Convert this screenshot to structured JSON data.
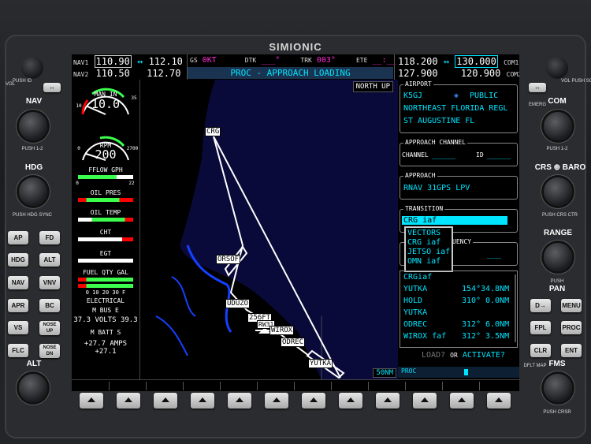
{
  "brand": "SIMIONIC",
  "nav": {
    "nav1_label": "NAV1",
    "nav1_active": "110.90",
    "nav1_arrow": "↔",
    "nav1_standby": "112.10",
    "nav2_label": "NAV2",
    "nav2_active": "110.50",
    "nav2_standby": "112.70"
  },
  "status": {
    "gs_label": "GS",
    "gs_value": "0KT",
    "dtk_label": "DTK",
    "dtk_value": "___°",
    "trk_label": "TRK",
    "trk_value": "003°",
    "ete_label": "ETE",
    "ete_value": "__:__",
    "proc_banner": "PROC - APPROACH LOADING"
  },
  "com": {
    "com1_active": "118.200",
    "com1_arrow": "↔",
    "com1_standby": "130.000",
    "com1_label": "COM1",
    "com2_active": "127.900",
    "com2_standby": "120.900",
    "com2_label": "COM2"
  },
  "eis": {
    "man_in_label": "MAN IN",
    "man_in_value": "10.0",
    "man_min": "10",
    "man_max": "35",
    "rpm_label": "RPM",
    "rpm_value": "200",
    "rpm_min": "0",
    "rpm_max": "2700",
    "fflow_label": "FFLOW GPH",
    "fflow_min": "0",
    "fflow_max": "22",
    "oil_pres_label": "OIL PRES",
    "oil_temp_label": "OIL TEMP",
    "cht_label": "CHT",
    "egt_label": "EGT",
    "fuel_label": "FUEL QTY GAL",
    "fuel_scale": "0   10  20  30 F",
    "elec_label": "ELECTRICAL",
    "bus_row": "M   BUS   E",
    "volts_row": "37.3 VOLTS 39.3",
    "batt_row": "M   BATT   S",
    "amps_row": "+27.7 AMPS +27.1"
  },
  "map": {
    "orientation": "NORTH UP",
    "range": "50NM",
    "waypoints": [
      {
        "name": "CRG"
      },
      {
        "name": "ORSOF"
      },
      {
        "name": "UDUZO"
      },
      {
        "name": "256FT"
      },
      {
        "name": "RW31"
      },
      {
        "name": "WIROX"
      },
      {
        "name": "ODREC"
      },
      {
        "name": "YUTKA"
      }
    ]
  },
  "fms": {
    "airport_title": "AIRPORT",
    "airport_id": "K5GJ",
    "airport_type": "PUBLIC",
    "airport_name": "NORTHEAST FLORIDA REGL",
    "airport_city": "ST AUGUSTINE FL",
    "channel_title": "APPROACH CHANNEL",
    "channel_label": "CHANNEL",
    "channel_value": "_____",
    "id_label": "ID",
    "id_value": "_____",
    "approach_title": "APPROACH",
    "approach_value": "RNAV 31GPS LPV",
    "transition_title": "TRANSITION",
    "transition_value": "CRG iaf",
    "dropdown": [
      "VECTORS",
      "CRG iaf",
      "JETSO iaf",
      "OMN iaf"
    ],
    "freq_title": "UENCY",
    "freq_value": "___",
    "legs": [
      {
        "name": "CRGiaf",
        "crs": "",
        "dist": ""
      },
      {
        "name": "YUTKA",
        "crs": "154°",
        "dist": "34.8NM"
      },
      {
        "name": "HOLD",
        "crs": "310°",
        "dist": "0.0NM"
      },
      {
        "name": "YUTKA",
        "crs": "",
        "dist": ""
      },
      {
        "name": "ODREC",
        "crs": "312°",
        "dist": "6.0NM"
      },
      {
        "name": "WIROX faf",
        "crs": "312°",
        "dist": "3.5NM"
      }
    ],
    "load_text": "LOAD?",
    "or_text": "OR",
    "activate_text": "ACTIVATE?",
    "proc_label": "PROC"
  },
  "left_panel": {
    "vol_label": "VOL",
    "push_id": "PUSH ID",
    "nav_label": "NAV",
    "push_12": "PUSH 1-2",
    "hdg_label": "HDG",
    "push_hdg_sync": "PUSH HDG SYNC",
    "buttons": [
      "AP",
      "FD",
      "HDG",
      "ALT",
      "NAV",
      "VNV",
      "APR",
      "BC",
      "VS",
      "NOSE UP",
      "FLC",
      "NOSE DN"
    ],
    "alt_label": "ALT"
  },
  "right_panel": {
    "vol_sq": "VOL PUSH SQ",
    "com_label": "COM",
    "emerg": "EMERG",
    "push_12": "PUSH 1-2",
    "crs_baro": "CRS ⊕ BARO",
    "push_crs_ctr": "PUSH CRS CTR",
    "range_label": "RANGE",
    "push_pan": "PUSH",
    "pan_label": "PAN",
    "buttons": [
      "D→",
      "MENU",
      "FPL",
      "PROC",
      "CLR",
      "ENT"
    ],
    "dflt_map": "DFLT MAP",
    "fms_label": "FMS",
    "push_crsr": "PUSH CRSR"
  }
}
